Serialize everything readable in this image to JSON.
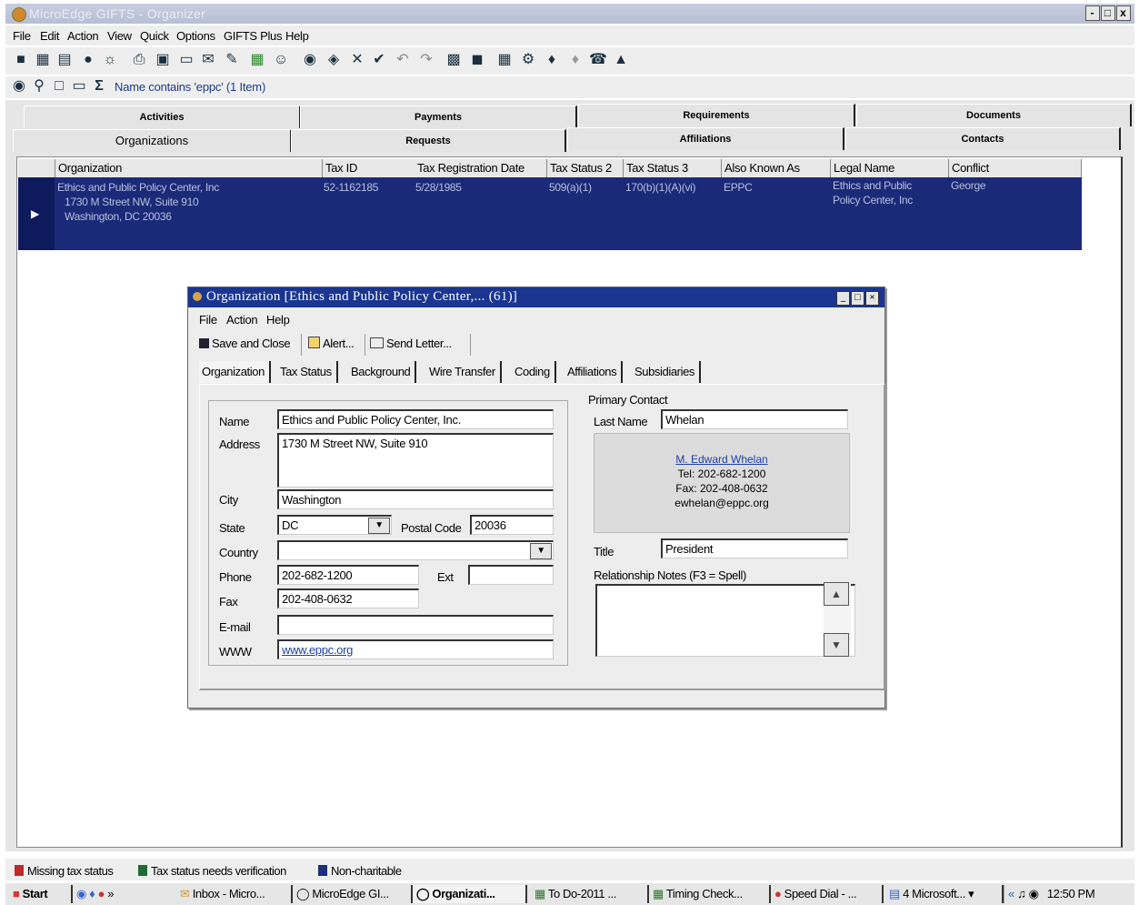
{
  "app": {
    "title": "MicroEdge GIFTS - Organizer",
    "window_controls": [
      "-",
      "□",
      "x"
    ]
  },
  "menu": [
    "File",
    "Edit",
    "Action",
    "View",
    "Quick",
    "Options",
    "GIFTS Plus",
    "Help"
  ],
  "findbar": {
    "query": "Name contains 'eppc'  (1 Item)"
  },
  "tabs_row1": [
    "Activities",
    "Payments",
    "Requirements",
    "Documents"
  ],
  "tabs_row2": [
    "Organizations",
    "Requests",
    "Affiliations",
    "Contacts"
  ],
  "grid": {
    "columns": [
      "Organization",
      "Tax ID",
      "Tax Registration Date",
      "Tax Status 2",
      "Tax Status 3",
      "Also Known As",
      "Legal Name",
      "Conflict"
    ],
    "row": {
      "organization": [
        "Ethics and Public Policy Center, Inc",
        "1730 M Street NW, Suite 910",
        "Washington, DC 20036"
      ],
      "tax_id": "52-1162185",
      "tax_registration_date": "5/28/1985",
      "tax_status_2": "509(a)(1)",
      "tax_status_3": "170(b)(1)(A)(vi)",
      "also_known_as": "EPPC",
      "legal_name": [
        "Ethics and Public",
        "Policy Center, Inc"
      ],
      "conflict": "George"
    }
  },
  "dialog": {
    "title": "Organization [Ethics and Public Policy Center,... (61)]",
    "menu": [
      "File",
      "Action",
      "Help"
    ],
    "toolbar": [
      "Save and Close",
      "Alert...",
      "Send Letter..."
    ],
    "tabs": [
      "Organization",
      "Tax Status",
      "Background",
      "Wire Transfer",
      "Coding",
      "Affiliations",
      "Subsidiaries"
    ],
    "labels": {
      "name": "Name",
      "address": "Address",
      "city": "City",
      "state": "State",
      "postal": "Postal Code",
      "country": "Country",
      "phone": "Phone",
      "ext": "Ext",
      "fax": "Fax",
      "email": "E-mail",
      "www": "WWW",
      "primary_contact": "Primary Contact",
      "last_name": "Last Name",
      "title": "Title",
      "notes": "Relationship Notes   (F3 = Spell)"
    },
    "values": {
      "name": "Ethics and Public Policy Center, Inc.",
      "address": "1730 M Street NW, Suite 910",
      "city": "Washington",
      "state": "DC",
      "postal": "20036",
      "country": "",
      "phone": "202-682-1200",
      "ext": "",
      "fax": "202-408-0632",
      "email": "",
      "www": "www.eppc.org",
      "last_name": "Whelan",
      "title": "President",
      "notes": ""
    },
    "contact_card": {
      "name": "M. Edward Whelan",
      "tel": "Tel: 202-682-1200",
      "fax": "Fax: 202-408-0632",
      "email": "ewhelan@eppc.org"
    }
  },
  "legend": [
    {
      "label": "Missing tax status",
      "color": "#c0282a"
    },
    {
      "label": "Tax status needs verification",
      "color": "#1e6b35"
    },
    {
      "label": "Non-charitable",
      "color": "#1b2f7a"
    }
  ],
  "taskbar": {
    "start": "Start",
    "items": [
      "Inbox - Micro...",
      "MicroEdge GI...",
      "Organizati...",
      "To Do-2011 ...",
      "Timing Check...",
      "Speed Dial - ...",
      "4 Microsoft..."
    ],
    "clock": "12:50 PM"
  }
}
